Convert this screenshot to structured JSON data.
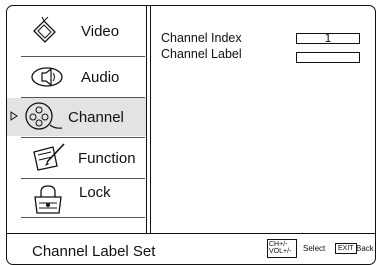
{
  "sidebar": {
    "items": [
      {
        "label": "Video",
        "icon": "video-icon"
      },
      {
        "label": "Audio",
        "icon": "audio-icon"
      },
      {
        "label": "Channel",
        "icon": "channel-icon",
        "selected": true
      },
      {
        "label": "Function",
        "icon": "function-icon"
      },
      {
        "label": "Lock",
        "icon": "lock-icon"
      }
    ]
  },
  "main": {
    "rows": [
      {
        "label": "Channel Index",
        "value": "1"
      },
      {
        "label": "Channel Label",
        "value": ""
      }
    ]
  },
  "status": {
    "title": "Channel Label Set",
    "ch_key": "CH+/-",
    "vol_key": "VOL+/-",
    "select_hint": "Select",
    "exit_key": "EXIT",
    "back_hint": "Back"
  }
}
